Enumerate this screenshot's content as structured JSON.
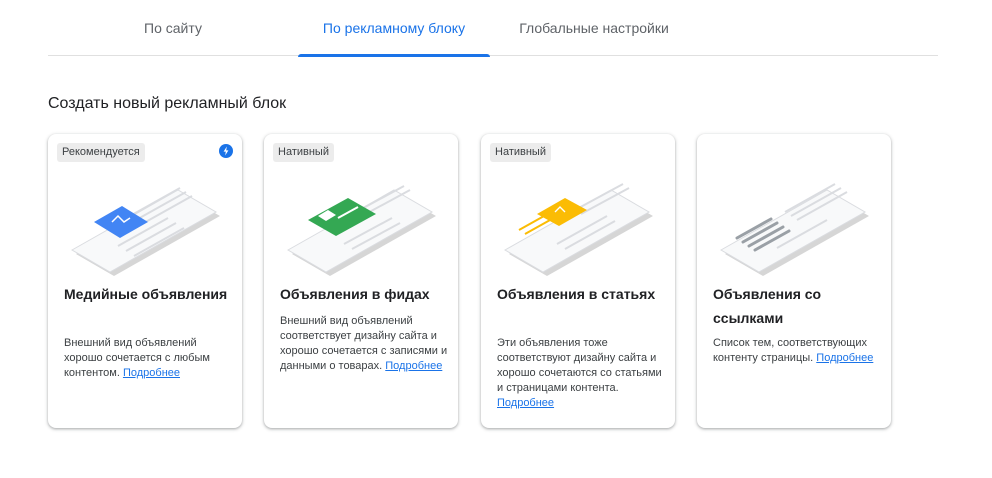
{
  "tabs": [
    {
      "label": "По сайту",
      "active": false
    },
    {
      "label": "По рекламному блоку",
      "active": true
    },
    {
      "label": "Глобальные настройки",
      "active": false
    }
  ],
  "section_title": "Создать новый рекламный блок",
  "colors": {
    "accent": "#1a73e8",
    "media_ad": "#4285f4",
    "feed_ad": "#34a853",
    "article_ad": "#fbbc04",
    "link_ad": "#9aa0a6"
  },
  "cards": [
    {
      "badge": "Рекомендуется",
      "badge_icon": "lightning-bolt-icon",
      "illustration": "media-ad-illustration",
      "title": "Медийные объявления",
      "description": "Внешний вид объявлений хорошо сочетается с любым контентом.",
      "link": "Подробнее"
    },
    {
      "badge": "Нативный",
      "illustration": "feed-ad-illustration",
      "title": "Объявления в фидах",
      "description": "Внешний вид объявлений соответствует дизайну сайта и хорошо сочетается с записями и данными о товарах.",
      "link": "Подробнее"
    },
    {
      "badge": "Нативный",
      "illustration": "article-ad-illustration",
      "title": "Объявления в статьях",
      "description": "Эти объявления тоже соответствуют дизайну сайта и хорошо сочетаются со статьями и страницами контента.",
      "link": "Подробнее"
    },
    {
      "illustration": "link-ad-illustration",
      "title": "Объявления со ссылками",
      "description": "Список тем, соответствующих контенту страницы.",
      "link": "Подробнее"
    }
  ]
}
